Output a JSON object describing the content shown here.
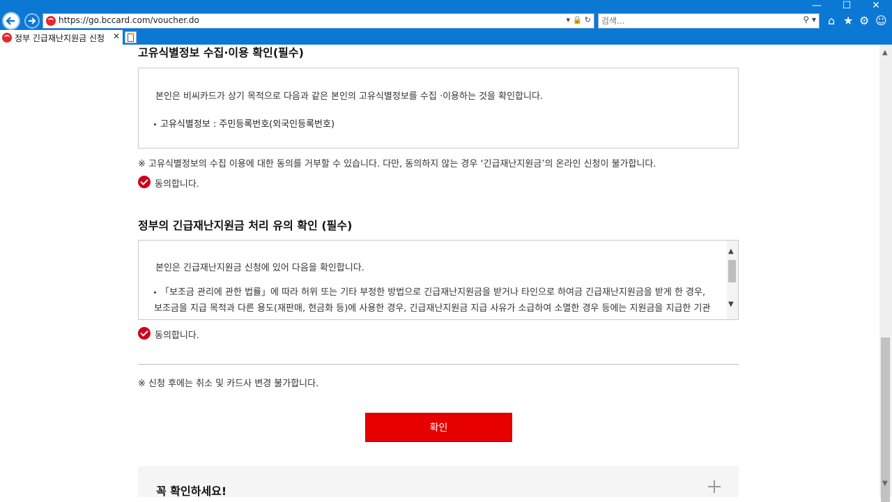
{
  "browser": {
    "url": "https://go.bccard.com/voucher.do",
    "search_placeholder": "검색...",
    "tab_title": "정부 긴급재난지원금 신청",
    "tab_close": "✕",
    "win_minimize": "—",
    "win_maximize": "☐",
    "win_close": "✕",
    "icons": [
      "back-icon",
      "forward-icon",
      "lock-icon",
      "refresh-icon",
      "search-icon",
      "home-icon",
      "star-icon",
      "gear-icon",
      "smiley-icon"
    ]
  },
  "section1": {
    "title": "고유식별정보 수집·이용 확인(필수)",
    "body": "본인은 비씨카드가 상기 목적으로 다음과 같은 본인의 고유식별정보를 수집 ·이용하는 것을 확인합니다.",
    "bullet": "고유식별정보 : 주민등록번호(외국인등록번호)",
    "note": "※ 고유식별정보의 수집 이용에 대한 동의를 거부할 수 있습니다. 다만, 동의하지 않는 경우 ‘긴급재난지원금’의 온라인 신청이 불가합니다.",
    "agree": "동의합니다."
  },
  "section2": {
    "title": "정부의 긴급재난지원금 처리 유의 확인 (필수)",
    "body": "본인은 긴급재난지원금 신청에 있어 다음을 확인합니다.",
    "bullet": "「보조금 관리에 관한 법률」에 따라 허위 또는 기타 부정한 방법으로 긴급재난지원금을 받거나 타인으로 하여금 긴급재난지원금을 받게 한 경우, 보조금을 지급 목적과 다른 용도(재판매, 현금화 등)에 사용한 경우, 긴급재난지원금 지급 사유가 소급하여 소멸한 경우 등에는 지원금을 지급한 기관이 그 비용의 전부 또는 일부를 환수할 수 있으며, 관련 법령에 따라 처벌받을 수 있습니다.",
    "agree": "동의합니다."
  },
  "notice": "※ 신청 후에는 취소 및 카드사 변경 불가합니다.",
  "confirm_button": "확인",
  "must_check_title": "꼭 확인하세요!"
}
